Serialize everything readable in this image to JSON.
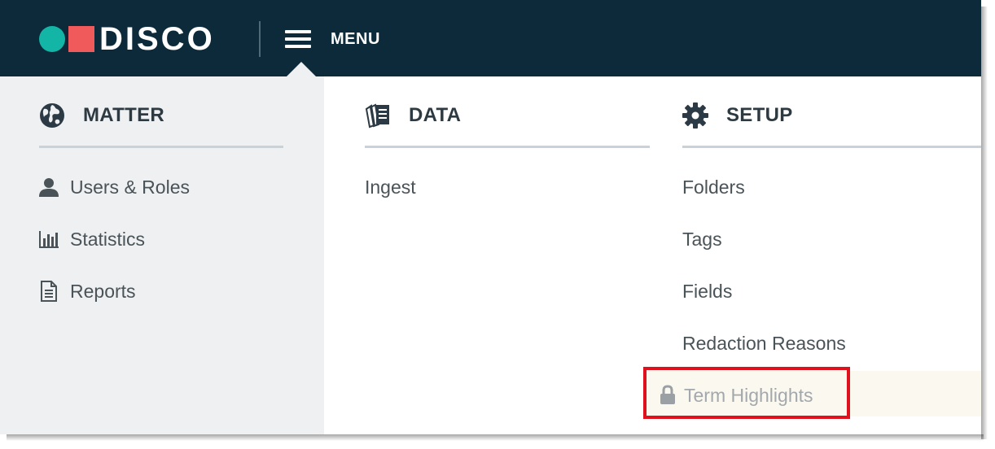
{
  "header": {
    "logo_text": "DISCO",
    "menu_label": "MENU",
    "colors": {
      "bar": "#0c2a3a",
      "logo_dot": "#13b5a6",
      "logo_square": "#f05a5a"
    }
  },
  "columns": {
    "matter": {
      "title": "MATTER",
      "icon": "globe-icon",
      "items": [
        {
          "label": "Users & Roles",
          "icon": "user-icon"
        },
        {
          "label": "Statistics",
          "icon": "bar-chart-icon"
        },
        {
          "label": "Reports",
          "icon": "document-icon"
        }
      ]
    },
    "data": {
      "title": "DATA",
      "icon": "documents-icon",
      "items": [
        {
          "label": "Ingest"
        }
      ]
    },
    "setup": {
      "title": "SETUP",
      "icon": "gear-icon",
      "items": [
        {
          "label": "Folders"
        },
        {
          "label": "Tags"
        },
        {
          "label": "Fields"
        },
        {
          "label": "Redaction Reasons"
        },
        {
          "label": "Term Highlights",
          "icon": "lock-icon",
          "state": "disabled"
        }
      ]
    }
  },
  "annotation": {
    "highlight_color": "#e0101c"
  }
}
